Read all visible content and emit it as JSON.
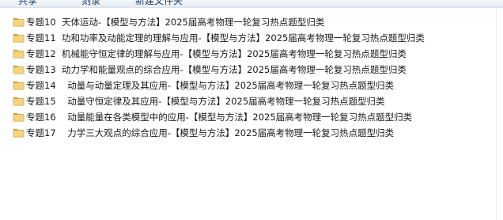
{
  "toolbar": {
    "items": [
      {
        "label": "共享"
      },
      {
        "label": "刻录"
      },
      {
        "label": "新建文件夹"
      }
    ]
  },
  "folders": [
    {
      "name": "专题10  天体运动-【模型与方法】2025届高考物理一轮复习热点题型归类",
      "icon": "folder-icon"
    },
    {
      "name": "专题11  功和功率及动能定理的理解与应用-【模型与方法】2025届高考物理一轮复习热点题型归类",
      "icon": "folder-icon"
    },
    {
      "name": "专题12  机械能守恒定律的理解与应用-【模型与方法】2025届高考物理一轮复习热点题型归类",
      "icon": "folder-icon"
    },
    {
      "name": "专题13  动力学和能量观点的综合应用-【模型与方法】2025届高考物理一轮复习热点题型归类",
      "icon": "folder-icon"
    },
    {
      "name": "专题14    动量与动量定理及其应用-【模型与方法】2025届高考物理一轮复习热点题型归类",
      "icon": "folder-icon"
    },
    {
      "name": "专题15    动量守恒定律及其应用-【模型与方法】2025届高考物理一轮复习热点题型归类",
      "icon": "folder-icon"
    },
    {
      "name": "专题16    动量能量在各类模型中的应用-【模型与方法】2025届高考物理一轮复习热点题型归类",
      "icon": "folder-icon"
    },
    {
      "name": "专题17    力学三大观点的综合应用-【模型与方法】2025届高考物理一轮复习热点题型归类",
      "icon": "folder-icon"
    }
  ],
  "colors": {
    "folder_body": "#e8b84a",
    "folder_tab": "#d9a23a",
    "folder_front": "#f6d47c"
  }
}
